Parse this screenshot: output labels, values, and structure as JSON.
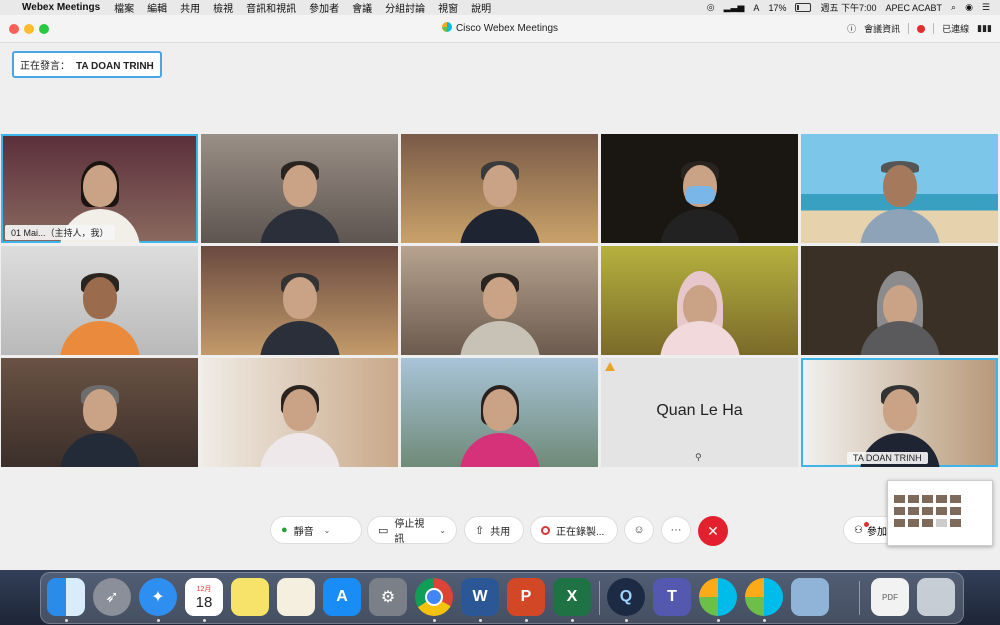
{
  "menubar": {
    "app_name": "Webex Meetings",
    "items": [
      "檔案",
      "編輯",
      "共用",
      "檢視",
      "音訊和視訊",
      "參加者",
      "會議",
      "分組討論",
      "視窗",
      "說明"
    ],
    "battery": "17%",
    "clock": "週五 下午7:00",
    "user": "APEC ACABT"
  },
  "window": {
    "title": "Cisco Webex Meetings",
    "meeting_info": "會議資訊",
    "connected": "已連線"
  },
  "speaking": {
    "label": "正在發言：",
    "name": "TA DOAN TRINH"
  },
  "tiles": [
    {
      "label": "01 Mai...（主持人，我）"
    },
    {
      "label": ""
    },
    {
      "label": ""
    },
    {
      "label": ""
    },
    {
      "label": ""
    },
    {
      "label": ""
    },
    {
      "label": ""
    },
    {
      "label": ""
    },
    {
      "label": ""
    },
    {
      "label": ""
    },
    {
      "label": ""
    },
    {
      "label": ""
    },
    {
      "label": ""
    },
    {
      "name": "Quan Le Ha"
    },
    {
      "label": "TA DOAN TRINH"
    }
  ],
  "controls": {
    "mute": "靜音",
    "stop_video": "停止視訊",
    "share": "共用",
    "recording": "正在錄製...",
    "more": "···",
    "participants": "參加"
  },
  "dock": {
    "calendar_month": "12月",
    "calendar_day": "18"
  },
  "colors": {
    "accent": "#3fb4e8",
    "end_call": "#e3202d",
    "mic": "#2a9d3a"
  }
}
